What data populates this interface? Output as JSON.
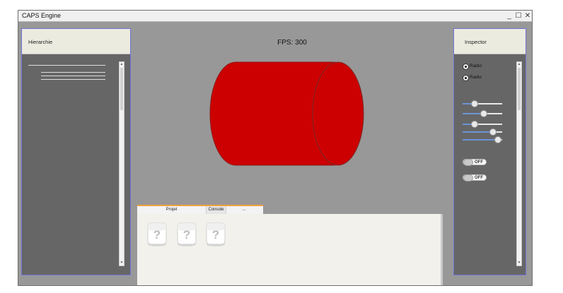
{
  "window": {
    "title": "CAPS Engine"
  },
  "controls": {
    "minimize": "_",
    "maximize": "☐",
    "close": "✕"
  },
  "hierarchy": {
    "title": "Hierarchie"
  },
  "viewport": {
    "fps_label": "FPS: 300",
    "object_color": "#cc0000"
  },
  "inspector": {
    "title": "Inspector",
    "radios": [
      {
        "label": "Radio"
      },
      {
        "label": "Radio"
      }
    ],
    "sliders": [
      {
        "value": 0.25
      },
      {
        "value": 0.55
      },
      {
        "value": 0.25
      },
      {
        "value": 0.82
      },
      {
        "value": 0.97
      }
    ],
    "toggles": [
      {
        "label": "OFF"
      },
      {
        "label": "OFF"
      }
    ]
  },
  "bottom_panel": {
    "tabs": [
      {
        "label": "Projet"
      },
      {
        "label": "Console"
      },
      {
        "label": "..."
      }
    ],
    "icons": [
      {
        "glyph": "?"
      },
      {
        "glyph": "?"
      },
      {
        "glyph": "?"
      }
    ]
  },
  "colors": {
    "accent": "#f0a23c",
    "panel_border": "#6f74d8",
    "background": "#989898"
  }
}
